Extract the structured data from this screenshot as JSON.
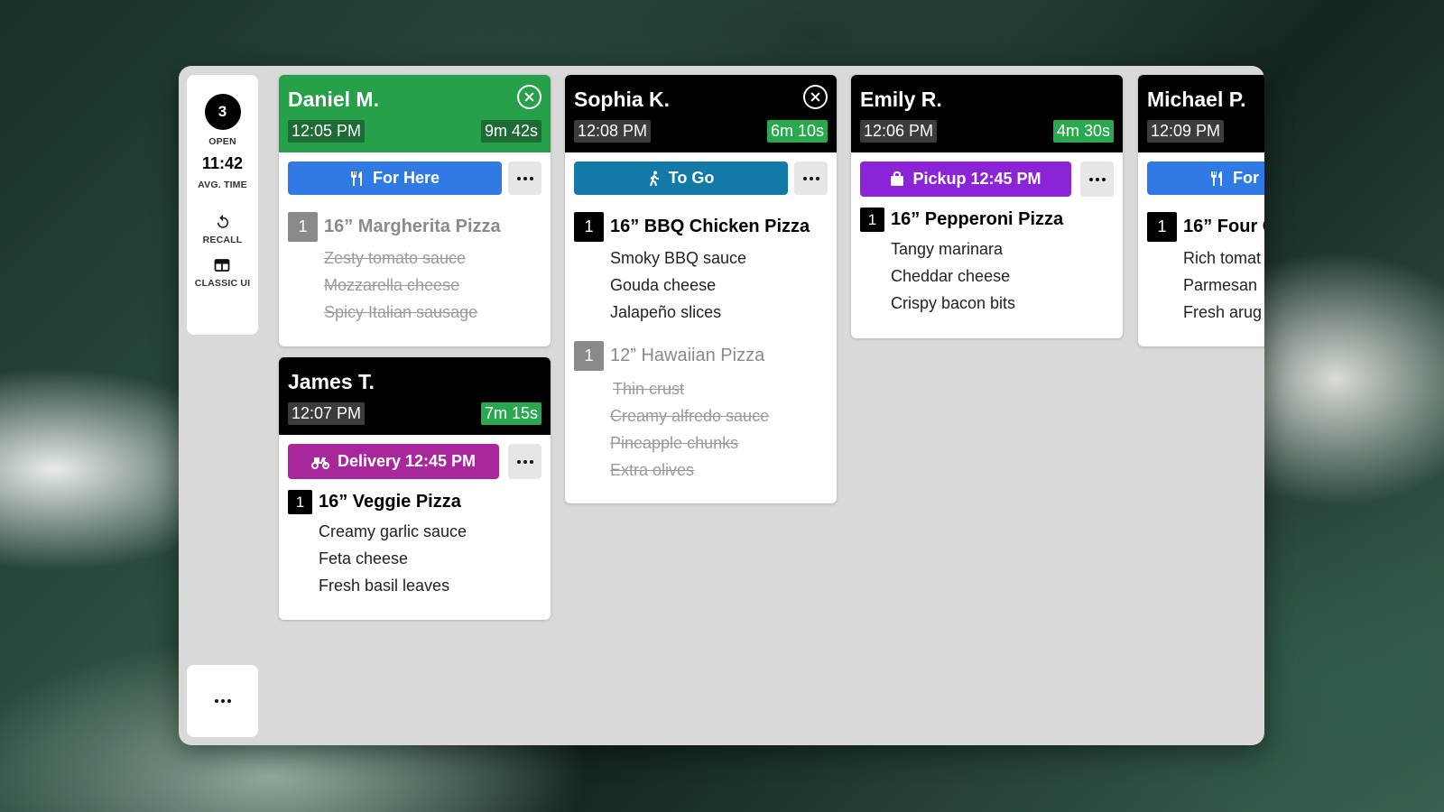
{
  "sidebar": {
    "open_count": "3",
    "open_label": "OPEN",
    "avg_time": "11:42",
    "avg_label": "AVG. TIME",
    "recall_label": "RECALL",
    "classic_label": "CLASSIC UI"
  },
  "orders": [
    {
      "name": "Daniel M.",
      "time": "12:05 PM",
      "elapsed": "9m 42s",
      "type": "For Here",
      "items": [
        {
          "qty": "1",
          "name": "16” Margherita Pizza",
          "done": true,
          "mods": [
            "Zesty tomato sauce",
            "Mozzarella cheese",
            "Spicy Italian sausage"
          ]
        }
      ]
    },
    {
      "name": "James T.",
      "time": "12:07 PM",
      "elapsed": "7m 15s",
      "type": "Delivery 12:45 PM",
      "items": [
        {
          "qty": "1",
          "name": "16” Veggie Pizza",
          "done": false,
          "mods": [
            "Creamy garlic sauce",
            "Feta cheese",
            "Fresh basil leaves"
          ]
        }
      ]
    },
    {
      "name": "Sophia K.",
      "time": "12:08 PM",
      "elapsed": "6m 10s",
      "type": "To Go",
      "items": [
        {
          "qty": "1",
          "name": "16” BBQ Chicken Pizza",
          "done": false,
          "mods": [
            "Smoky BBQ sauce",
            "Gouda cheese",
            "Jalapeño slices"
          ]
        },
        {
          "qty": "1",
          "name": "12” Hawaiian Pizza",
          "done": true,
          "mods": [
            "Thin crust",
            "Creamy alfredo sauce",
            "Pineapple chunks",
            "Extra olives"
          ]
        }
      ]
    },
    {
      "name": "Emily R.",
      "time": "12:06 PM",
      "elapsed": "4m 30s",
      "type": "Pickup 12:45 PM",
      "items": [
        {
          "qty": "1",
          "name": "16” Pepperoni Pizza",
          "done": false,
          "mods": [
            "Tangy marinara",
            "Cheddar cheese",
            "Crispy bacon bits"
          ]
        }
      ]
    },
    {
      "name": "Michael P.",
      "time": "12:09 PM",
      "type": "For",
      "items": [
        {
          "qty": "1",
          "name": "16” Four C",
          "done": false,
          "mods": [
            "Rich tomat",
            "Parmesan",
            "Fresh arug"
          ]
        }
      ]
    }
  ]
}
